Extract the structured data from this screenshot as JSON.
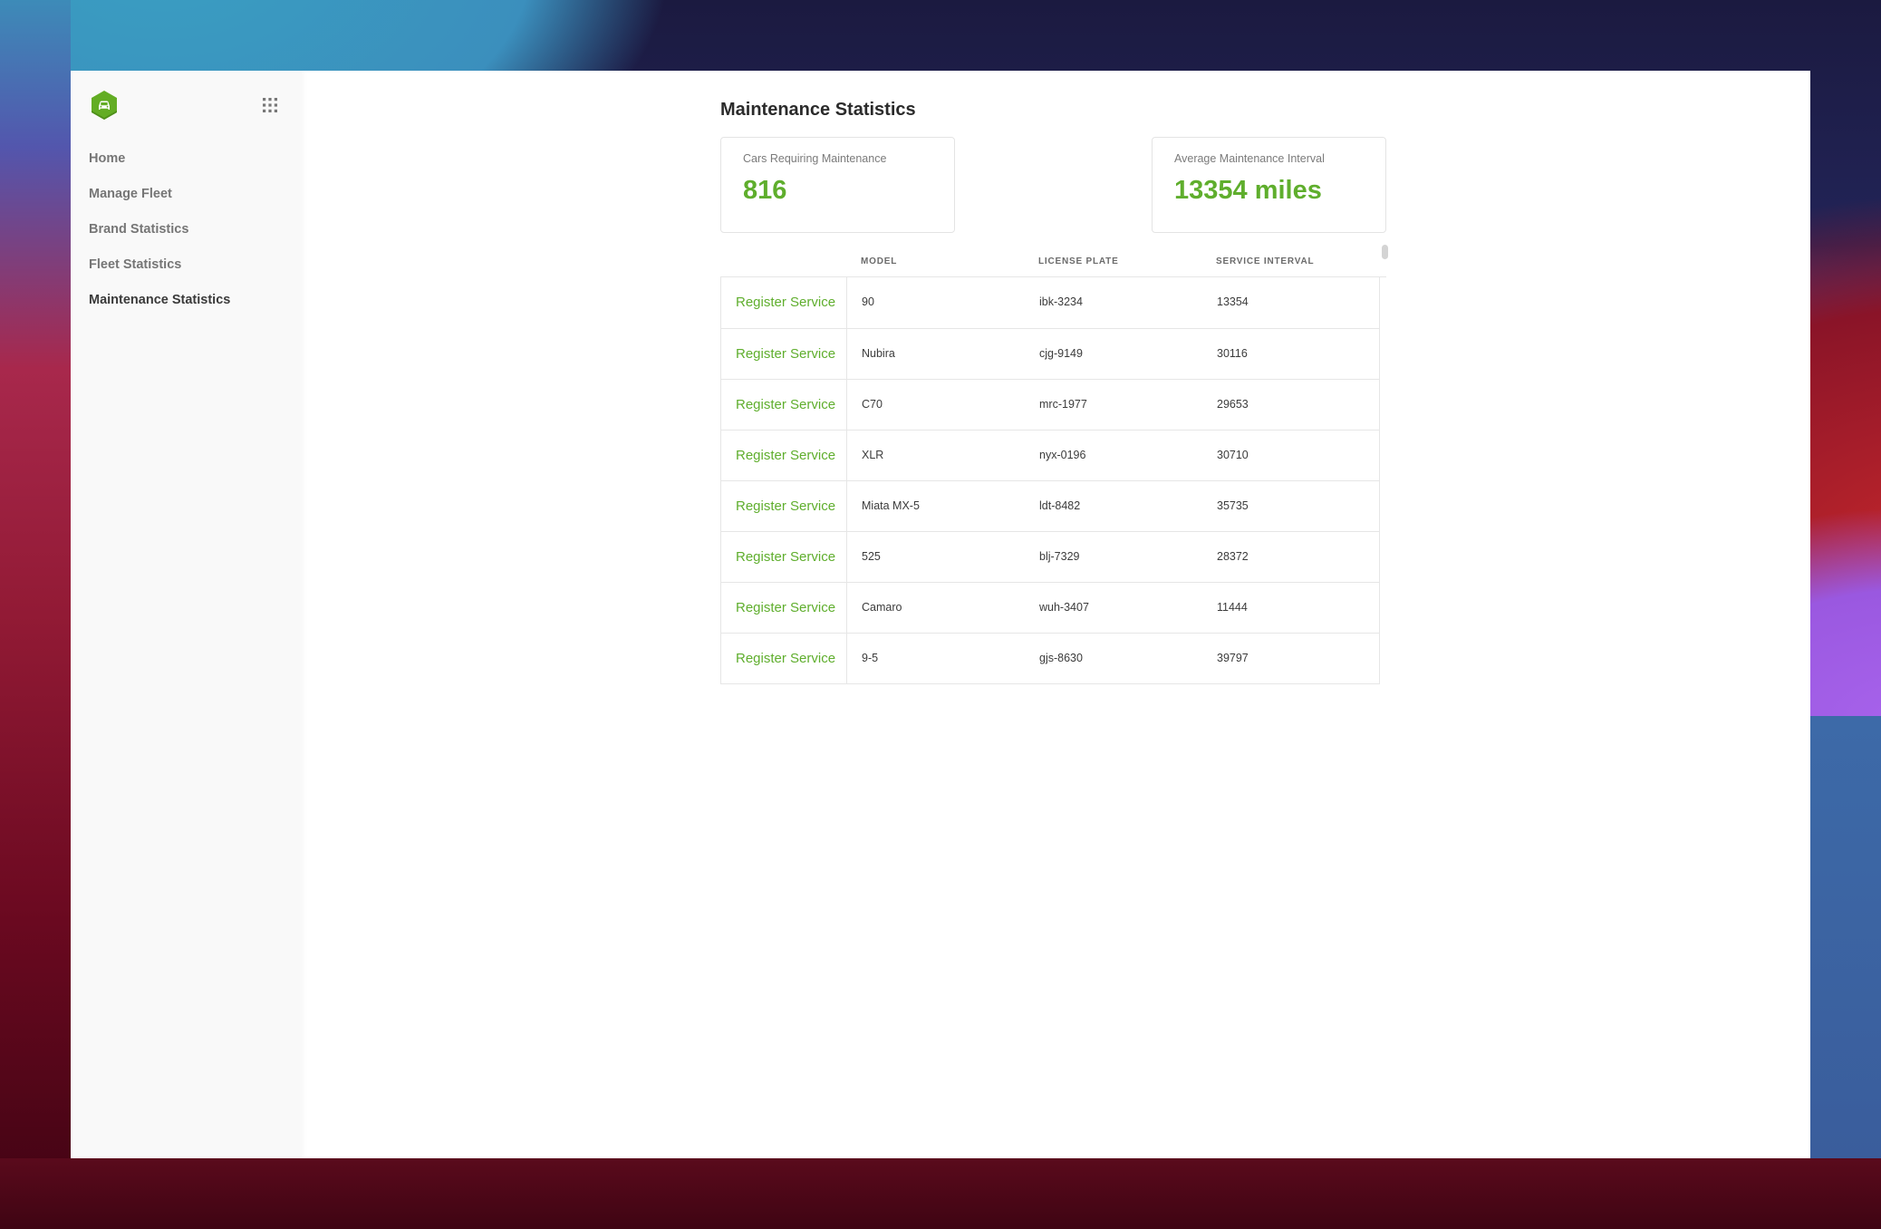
{
  "sidebar": {
    "logo_icon": "car-hexagon-logo",
    "apps_icon": "grid-icon",
    "items": [
      {
        "label": "Home",
        "active": false
      },
      {
        "label": "Manage Fleet",
        "active": false
      },
      {
        "label": "Brand Statistics",
        "active": false
      },
      {
        "label": "Fleet Statistics",
        "active": false
      },
      {
        "label": "Maintenance Statistics",
        "active": true
      }
    ]
  },
  "page": {
    "title": "Maintenance Statistics"
  },
  "stats": {
    "cars_requiring_maintenance": {
      "label": "Cars Requiring Maintenance",
      "value": "816"
    },
    "average_interval": {
      "label": "Average Maintenance Interval",
      "value": "13354 miles"
    }
  },
  "table": {
    "columns": [
      "",
      "MODEL",
      "LICENSE PLATE",
      "SERVICE INTERVAL"
    ],
    "action_label": "Register Service",
    "rows": [
      {
        "action": "Register Service",
        "model": "90",
        "plate": "ibk-3234",
        "interval": "13354"
      },
      {
        "action": "Register Service",
        "model": "Nubira",
        "plate": "cjg-9149",
        "interval": "30116"
      },
      {
        "action": "Register Service",
        "model": "C70",
        "plate": "mrc-1977",
        "interval": "29653"
      },
      {
        "action": "Register Service",
        "model": "XLR",
        "plate": "nyx-0196",
        "interval": "30710"
      },
      {
        "action": "Register Service",
        "model": "Miata MX-5",
        "plate": "ldt-8482",
        "interval": "35735"
      },
      {
        "action": "Register Service",
        "model": "525",
        "plate": "blj-7329",
        "interval": "28372"
      },
      {
        "action": "Register Service",
        "model": "Camaro",
        "plate": "wuh-3407",
        "interval": "11444"
      },
      {
        "action": "Register Service",
        "model": "9-5",
        "plate": "gjs-8630",
        "interval": "39797"
      }
    ]
  },
  "colors": {
    "accent": "#5fae2d",
    "sidebar_bg": "#f9f9f9",
    "text_muted": "#767676",
    "text_active": "#3a3a3a"
  }
}
